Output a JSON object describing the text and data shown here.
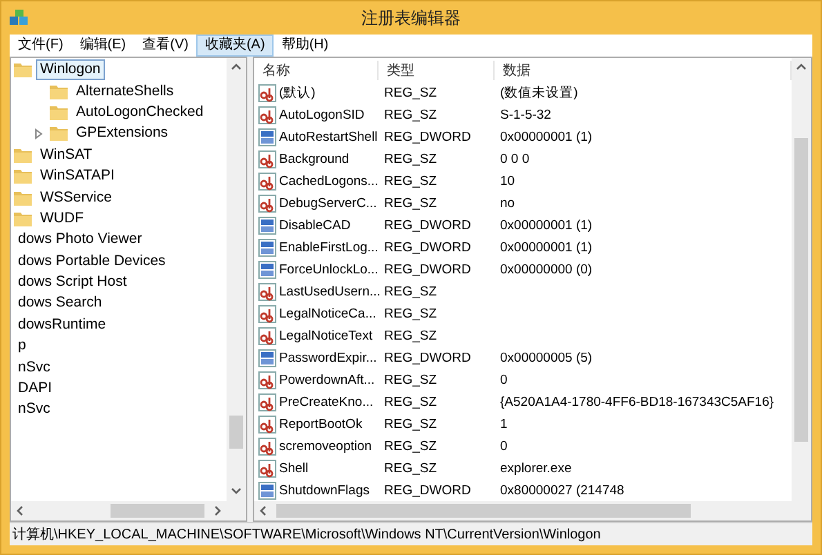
{
  "window": {
    "title": "注册表编辑器"
  },
  "menu": [
    {
      "label": "文件(F)",
      "selected": false
    },
    {
      "label": "编辑(E)",
      "selected": false
    },
    {
      "label": "查看(V)",
      "selected": false
    },
    {
      "label": "收藏夹(A)",
      "selected": true
    },
    {
      "label": "帮助(H)",
      "selected": false
    }
  ],
  "tree": {
    "items": [
      {
        "kind": "folder",
        "label": "Winlogon",
        "selected": true,
        "children": [
          {
            "kind": "folder",
            "label": "AlternateShells",
            "selected": false
          },
          {
            "kind": "folder",
            "label": "AutoLogonChecked",
            "selected": false
          },
          {
            "kind": "folder",
            "label": "GPExtensions",
            "selected": false,
            "expanded": false
          }
        ]
      },
      {
        "kind": "folder",
        "label": "WinSAT",
        "selected": false
      },
      {
        "kind": "folder",
        "label": "WinSATAPI",
        "selected": false
      },
      {
        "kind": "folder",
        "label": "WSService",
        "selected": false
      },
      {
        "kind": "folder",
        "label": "WUDF",
        "selected": false
      },
      {
        "kind": "text",
        "label": "dows Photo Viewer",
        "selected": false
      },
      {
        "kind": "text",
        "label": "dows Portable Devices",
        "selected": false
      },
      {
        "kind": "text",
        "label": "dows Script Host",
        "selected": false
      },
      {
        "kind": "text",
        "label": "dows Search",
        "selected": false
      },
      {
        "kind": "text",
        "label": "dowsRuntime",
        "selected": false
      },
      {
        "kind": "text",
        "label": "p",
        "selected": false
      },
      {
        "kind": "text",
        "label": "nSvc",
        "selected": false
      },
      {
        "kind": "text",
        "label": "DAPI",
        "selected": false
      },
      {
        "kind": "text",
        "label": "nSvc",
        "selected": false
      }
    ]
  },
  "table": {
    "columns": [
      "名称",
      "类型",
      "数据"
    ],
    "rows": [
      {
        "kind": "string",
        "name": "(默认)",
        "type": "REG_SZ",
        "data": "(数值未设置)"
      },
      {
        "kind": "string",
        "name": "AutoLogonSID",
        "type": "REG_SZ",
        "data": "S-1-5-32"
      },
      {
        "kind": "binary",
        "name": "AutoRestartShell",
        "type": "REG_DWORD",
        "data": "0x00000001 (1)"
      },
      {
        "kind": "string",
        "name": "Background",
        "type": "REG_SZ",
        "data": "0 0 0"
      },
      {
        "kind": "string",
        "name": "CachedLogons...",
        "type": "REG_SZ",
        "data": "10"
      },
      {
        "kind": "string",
        "name": "DebugServerC...",
        "type": "REG_SZ",
        "data": "no"
      },
      {
        "kind": "binary",
        "name": "DisableCAD",
        "type": "REG_DWORD",
        "data": "0x00000001 (1)"
      },
      {
        "kind": "binary",
        "name": "EnableFirstLog...",
        "type": "REG_DWORD",
        "data": "0x00000001 (1)"
      },
      {
        "kind": "binary",
        "name": "ForceUnlockLo...",
        "type": "REG_DWORD",
        "data": "0x00000000 (0)"
      },
      {
        "kind": "string",
        "name": "LastUsedUsern...",
        "type": "REG_SZ"
      },
      {
        "kind": "string",
        "name": "LegalNoticeCa...",
        "type": "REG_SZ"
      },
      {
        "kind": "string",
        "name": "LegalNoticeText",
        "type": "REG_SZ"
      },
      {
        "kind": "binary",
        "name": "PasswordExpir...",
        "type": "REG_DWORD",
        "data": "0x00000005 (5)"
      },
      {
        "kind": "string",
        "name": "PowerdownAft...",
        "type": "REG_SZ",
        "data": "0"
      },
      {
        "kind": "string",
        "name": "PreCreateKno...",
        "type": "REG_SZ",
        "data": "{A520A1A4-1780-4FF6-BD18-167343C5AF16}"
      },
      {
        "kind": "string",
        "name": "ReportBootOk",
        "type": "REG_SZ",
        "data": "1"
      },
      {
        "kind": "string",
        "name": "scremoveoption",
        "type": "REG_SZ",
        "data": "0"
      },
      {
        "kind": "string",
        "name": "Shell",
        "type": "REG_SZ",
        "data": "explorer.exe"
      },
      {
        "kind": "binary",
        "name": "ShutdownFlags",
        "type": "REG_DWORD",
        "data": "0x80000027 (214748"
      }
    ]
  },
  "status_bar": "计算机\\HKEY_LOCAL_MACHINE\\SOFTWARE\\Microsoft\\Windows NT\\CurrentVersion\\Winlogon"
}
